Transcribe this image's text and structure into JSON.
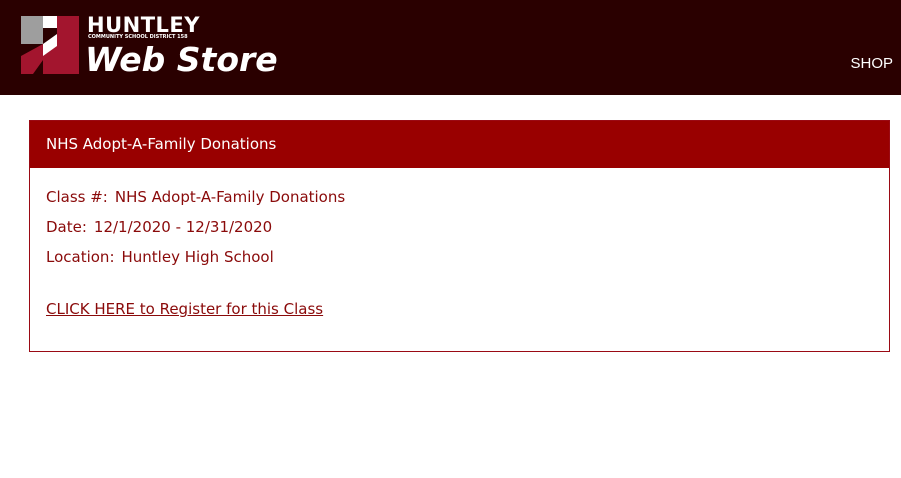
{
  "header": {
    "logo": {
      "icon": "huntley-h-logo-icon",
      "huntley": "HUNTLEY",
      "district": "COMMUNITY SCHOOL DISTRICT 158",
      "store": "Web Store"
    },
    "nav": {
      "shop_label": "SHOP"
    },
    "colors": {
      "background": "#2a0000",
      "logo_red": "#a3152e",
      "logo_gray": "#9e9e9e"
    }
  },
  "panel": {
    "title": "NHS Adopt-A-Family Donations",
    "fields": [
      {
        "label": "Class #:",
        "value": "NHS Adopt-A-Family Donations"
      },
      {
        "label": "Date:",
        "value": "12/1/2020 - 12/31/2020"
      },
      {
        "label": "Location:",
        "value": "Huntley High School"
      }
    ],
    "register_link": "CLICK HERE to Register for this Class",
    "colors": {
      "heading_bg": "#990000",
      "text": "#8a0a0a",
      "border": "#9a0a14"
    }
  }
}
